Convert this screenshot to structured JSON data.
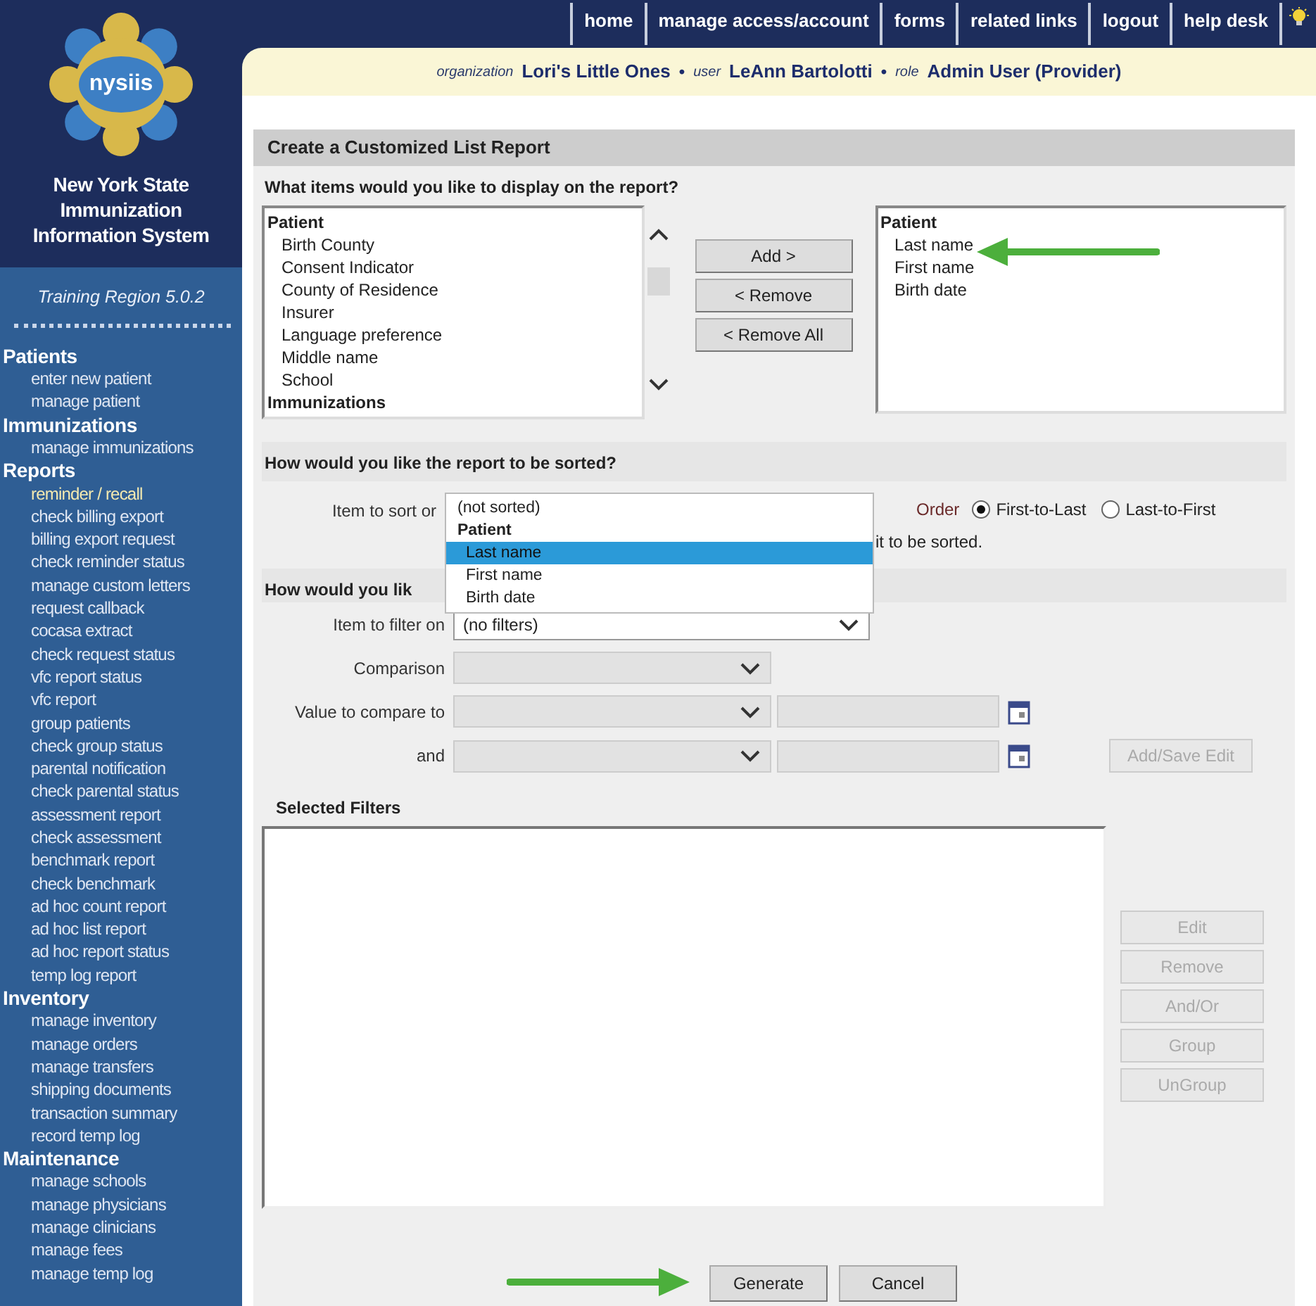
{
  "logo": {
    "text": "nysiis"
  },
  "system_title": "New York State Immunization Information System",
  "region": "Training Region 5.0.2",
  "sidebar": {
    "groups": [
      {
        "label": "Patients",
        "items": [
          {
            "label": "enter new patient",
            "selected": false
          },
          {
            "label": "manage patient",
            "selected": false
          }
        ]
      },
      {
        "label": "Immunizations",
        "items": [
          {
            "label": "manage immunizations",
            "selected": false
          }
        ]
      },
      {
        "label": "Reports",
        "items": [
          {
            "label": "reminder / recall",
            "selected": true
          },
          {
            "label": "check billing export",
            "selected": false
          },
          {
            "label": "billing export request",
            "selected": false
          },
          {
            "label": "check reminder status",
            "selected": false
          },
          {
            "label": "manage custom letters",
            "selected": false
          },
          {
            "label": "request callback",
            "selected": false
          },
          {
            "label": "cocasa extract",
            "selected": false
          },
          {
            "label": "check request status",
            "selected": false
          },
          {
            "label": "vfc report status",
            "selected": false
          },
          {
            "label": "vfc report",
            "selected": false
          },
          {
            "label": "group patients",
            "selected": false
          },
          {
            "label": "check group status",
            "selected": false
          },
          {
            "label": "parental notification",
            "selected": false
          },
          {
            "label": "check parental status",
            "selected": false
          },
          {
            "label": "assessment report",
            "selected": false
          },
          {
            "label": "check assessment",
            "selected": false
          },
          {
            "label": "benchmark report",
            "selected": false
          },
          {
            "label": "check benchmark",
            "selected": false
          },
          {
            "label": "ad hoc count report",
            "selected": false
          },
          {
            "label": "ad hoc list report",
            "selected": false
          },
          {
            "label": "ad hoc report status",
            "selected": false
          },
          {
            "label": "temp log report",
            "selected": false
          }
        ]
      },
      {
        "label": "Inventory",
        "items": [
          {
            "label": "manage inventory",
            "selected": false
          },
          {
            "label": "manage orders",
            "selected": false
          },
          {
            "label": "manage transfers",
            "selected": false
          },
          {
            "label": "shipping documents",
            "selected": false
          },
          {
            "label": "transaction summary",
            "selected": false
          },
          {
            "label": "record temp log",
            "selected": false
          }
        ]
      },
      {
        "label": "Maintenance",
        "items": [
          {
            "label": "manage schools",
            "selected": false
          },
          {
            "label": "manage physicians",
            "selected": false
          },
          {
            "label": "manage clinicians",
            "selected": false
          },
          {
            "label": "manage fees",
            "selected": false
          },
          {
            "label": "manage temp log",
            "selected": false
          }
        ]
      }
    ]
  },
  "top_nav": [
    {
      "label": "home"
    },
    {
      "label": "manage access/account"
    },
    {
      "label": "forms"
    },
    {
      "label": "related links"
    },
    {
      "label": "logout"
    },
    {
      "label": "help desk"
    }
  ],
  "context_bar": [
    {
      "kind": "label",
      "text": "organization"
    },
    {
      "kind": "value",
      "text": "Lori's Little Ones"
    },
    {
      "kind": "separator",
      "text": "•"
    },
    {
      "kind": "label",
      "text": "user"
    },
    {
      "kind": "value",
      "text": "LeAnn Bartolotti"
    },
    {
      "kind": "separator",
      "text": "•"
    },
    {
      "kind": "label",
      "text": "role"
    },
    {
      "kind": "value",
      "text": "Admin User (Provider)"
    }
  ],
  "page_title": "Create a Customized List Report",
  "display_section": {
    "heading": "What items would you like to display on the report?",
    "available": [
      {
        "kind": "group",
        "text": "Patient"
      },
      {
        "kind": "item",
        "text": "Birth County"
      },
      {
        "kind": "item",
        "text": "Consent Indicator"
      },
      {
        "kind": "item",
        "text": "County of Residence"
      },
      {
        "kind": "item",
        "text": "Insurer"
      },
      {
        "kind": "item",
        "text": "Language preference"
      },
      {
        "kind": "item",
        "text": "Middle name"
      },
      {
        "kind": "item",
        "text": "School"
      },
      {
        "kind": "group",
        "text": "Immunizations"
      }
    ],
    "buttons": [
      "Add >",
      "< Remove",
      "< Remove All"
    ],
    "chosen": [
      {
        "kind": "group",
        "text": "Patient"
      },
      {
        "kind": "item",
        "text": "Last name"
      },
      {
        "kind": "item",
        "text": "First name"
      },
      {
        "kind": "item",
        "text": "Birth date"
      }
    ]
  },
  "sort_section": {
    "heading": "How would you like the report to be sorted?",
    "item_label": "Item to sort or",
    "dropdown_options": [
      {
        "kind": "item",
        "text": "(not sorted)",
        "selected": false
      },
      {
        "kind": "group",
        "text": "Patient",
        "selected": false
      },
      {
        "kind": "item",
        "text": "Last name",
        "selected": true
      },
      {
        "kind": "item",
        "text": "First name",
        "selected": false
      },
      {
        "kind": "item",
        "text": "Birth date",
        "selected": false
      }
    ],
    "order_label": "Order",
    "order_options": [
      {
        "label": "First-to-Last",
        "selected": true
      },
      {
        "label": "Last-to-First",
        "selected": false
      }
    ],
    "note": "it to be sorted."
  },
  "filter_section": {
    "heading": "How would you lik",
    "fields": [
      {
        "kind": "select",
        "label": "Item to filter on",
        "value": "(no filters)",
        "disabled": false
      },
      {
        "kind": "select",
        "label": "Comparison",
        "disabled": true
      },
      {
        "kind": "range",
        "label": "Value to compare to",
        "disabled": true
      },
      {
        "kind": "range",
        "label": "and",
        "disabled": true
      }
    ],
    "add_save_button": {
      "label": "Add/Save Edit",
      "disabled": true
    },
    "selected_filters_label": "Selected Filters",
    "filter_buttons": [
      {
        "label": "Edit",
        "disabled": true
      },
      {
        "label": "Remove",
        "disabled": true
      },
      {
        "label": "And/Or",
        "disabled": true
      },
      {
        "label": "Group",
        "disabled": true
      },
      {
        "label": "UnGroup",
        "disabled": true
      }
    ]
  },
  "actions": [
    {
      "label": "Generate"
    },
    {
      "label": "Cancel"
    }
  ]
}
